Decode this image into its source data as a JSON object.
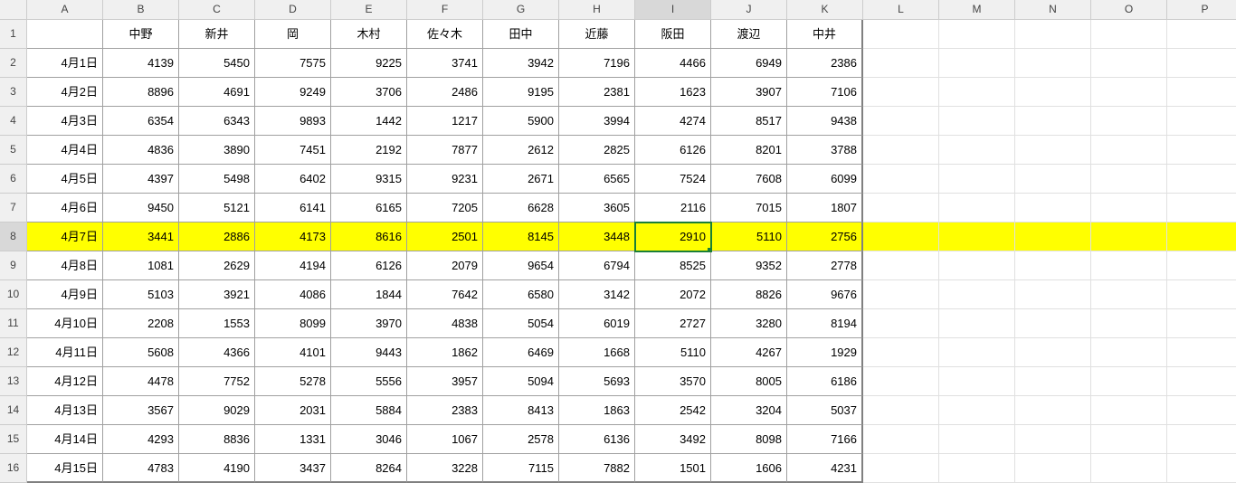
{
  "columns": [
    "A",
    "B",
    "C",
    "D",
    "E",
    "F",
    "G",
    "H",
    "I",
    "J",
    "K",
    "L",
    "M",
    "N",
    "O",
    "P"
  ],
  "rowcount": 16,
  "highlight_row_index": 7,
  "selected": {
    "row": 8,
    "col": "I"
  },
  "header_names": [
    "",
    "中野",
    "新井",
    "岡",
    "木村",
    "佐々木",
    "田中",
    "近藤",
    "阪田",
    "渡辺",
    "中井"
  ],
  "rows": [
    {
      "date": "4月1日",
      "vals": [
        4139,
        5450,
        7575,
        9225,
        3741,
        3942,
        7196,
        4466,
        6949,
        2386
      ]
    },
    {
      "date": "4月2日",
      "vals": [
        8896,
        4691,
        9249,
        3706,
        2486,
        9195,
        2381,
        1623,
        3907,
        7106
      ]
    },
    {
      "date": "4月3日",
      "vals": [
        6354,
        6343,
        9893,
        1442,
        1217,
        5900,
        3994,
        4274,
        8517,
        9438
      ]
    },
    {
      "date": "4月4日",
      "vals": [
        4836,
        3890,
        7451,
        2192,
        7877,
        2612,
        2825,
        6126,
        8201,
        3788
      ]
    },
    {
      "date": "4月5日",
      "vals": [
        4397,
        5498,
        6402,
        9315,
        9231,
        2671,
        6565,
        7524,
        7608,
        6099
      ]
    },
    {
      "date": "4月6日",
      "vals": [
        9450,
        5121,
        6141,
        6165,
        7205,
        6628,
        3605,
        2116,
        7015,
        1807
      ]
    },
    {
      "date": "4月7日",
      "vals": [
        3441,
        2886,
        4173,
        8616,
        2501,
        8145,
        3448,
        2910,
        5110,
        2756
      ]
    },
    {
      "date": "4月8日",
      "vals": [
        1081,
        2629,
        4194,
        6126,
        2079,
        9654,
        6794,
        8525,
        9352,
        2778
      ]
    },
    {
      "date": "4月9日",
      "vals": [
        5103,
        3921,
        4086,
        1844,
        7642,
        6580,
        3142,
        2072,
        8826,
        9676
      ]
    },
    {
      "date": "4月10日",
      "vals": [
        2208,
        1553,
        8099,
        3970,
        4838,
        5054,
        6019,
        2727,
        3280,
        8194
      ]
    },
    {
      "date": "4月11日",
      "vals": [
        5608,
        4366,
        4101,
        9443,
        1862,
        6469,
        1668,
        5110,
        4267,
        1929
      ]
    },
    {
      "date": "4月12日",
      "vals": [
        4478,
        7752,
        5278,
        5556,
        3957,
        5094,
        5693,
        3570,
        8005,
        6186
      ]
    },
    {
      "date": "4月13日",
      "vals": [
        3567,
        9029,
        2031,
        5884,
        2383,
        8413,
        1863,
        2542,
        3204,
        5037
      ]
    },
    {
      "date": "4月14日",
      "vals": [
        4293,
        8836,
        1331,
        3046,
        1067,
        2578,
        6136,
        3492,
        8098,
        7166
      ]
    },
    {
      "date": "4月15日",
      "vals": [
        4783,
        4190,
        3437,
        8264,
        3228,
        7115,
        7882,
        1501,
        1606,
        4231
      ]
    }
  ]
}
